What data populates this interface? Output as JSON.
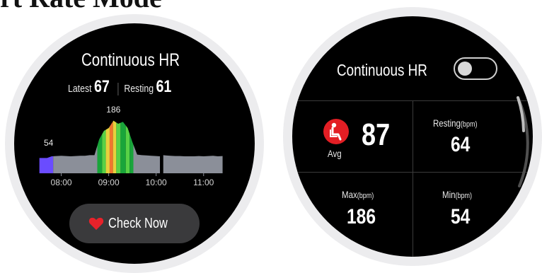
{
  "page_title": "rt Rate Mode",
  "left_watch": {
    "title": "Continuous HR",
    "latest_label": "Latest",
    "latest_value": "67",
    "resting_label": "Resting",
    "resting_value": "61",
    "check_button_label": "Check Now",
    "heart_color": "#e8222a",
    "chart_data": {
      "type": "area",
      "x_ticks": [
        "08:00",
        "09:00",
        "10:00",
        "11:00"
      ],
      "annotations": [
        {
          "label": "186",
          "type": "max"
        },
        {
          "label": "54",
          "type": "min"
        }
      ],
      "series": [
        {
          "x": [
            7.54,
            7.6,
            7.7,
            7.8,
            7.9,
            8.0,
            8.1,
            8.2,
            8.3,
            8.4,
            8.5,
            8.6,
            8.7,
            8.8,
            8.9,
            9.0,
            9.1,
            9.2,
            9.3,
            9.4,
            9.5,
            9.6,
            9.7,
            9.8,
            9.9,
            10.0,
            10.08
          ],
          "y": [
            54,
            54,
            54,
            60,
            61,
            62,
            61,
            60,
            61,
            62,
            62,
            64,
            64,
            120,
            150,
            160,
            186,
            175,
            182,
            160,
            110,
            66,
            64,
            63,
            62,
            61,
            60
          ]
        },
        {
          "x": [
            10.15,
            10.2,
            10.3,
            10.4,
            10.5,
            10.6,
            10.7,
            10.8,
            10.9,
            11.0,
            11.1,
            11.2,
            11.3,
            11.4
          ],
          "y": [
            64,
            63,
            62,
            61,
            61,
            60,
            60,
            60,
            61,
            60,
            61,
            62,
            60,
            61
          ]
        }
      ],
      "zone_colors": [
        "#6a4cff",
        "#19a53a",
        "#58d146",
        "#e7d13d",
        "#f1762f",
        "#8b8f99"
      ]
    }
  },
  "right_watch": {
    "title": "Continuous HR",
    "toggle_state": "off",
    "avg_label": "Avg",
    "avg_value": "87",
    "resting_label": "Resting",
    "resting_unit": "(bpm)",
    "resting_value": "64",
    "max_label": "Max",
    "max_unit": "(bpm)",
    "max_value": "186",
    "min_label": "Min",
    "min_unit": "(bpm)",
    "min_value": "54",
    "avg_icon": "seated-person-icon",
    "accent": "#e31e24"
  }
}
